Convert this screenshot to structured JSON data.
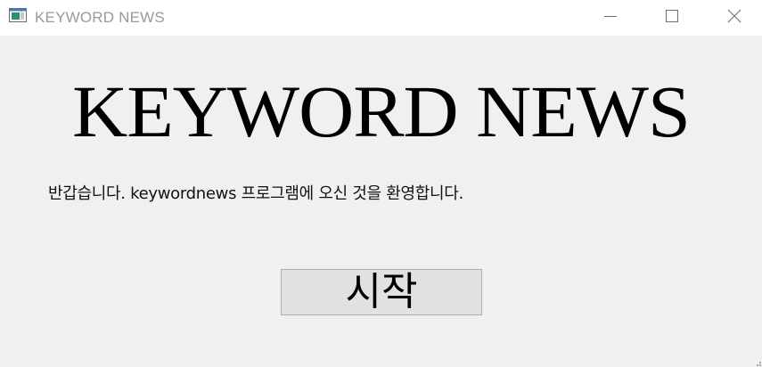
{
  "window": {
    "title": "KEYWORD NEWS",
    "app_icon": "window-app-icon",
    "controls": {
      "minimize_icon": "minimize-icon",
      "maximize_icon": "maximize-icon",
      "close_icon": "close-icon"
    }
  },
  "main": {
    "heading": "KEYWORD NEWS",
    "welcome_text": "반갑습니다. keywordnews 프로그램에 오신 것을 환영합니다.",
    "start_button_label": "시작"
  },
  "colors": {
    "background": "#f0f0f0",
    "titlebar": "#ffffff",
    "button_face": "#e1e1e1",
    "button_border": "#adadad",
    "title_text": "#999999"
  }
}
